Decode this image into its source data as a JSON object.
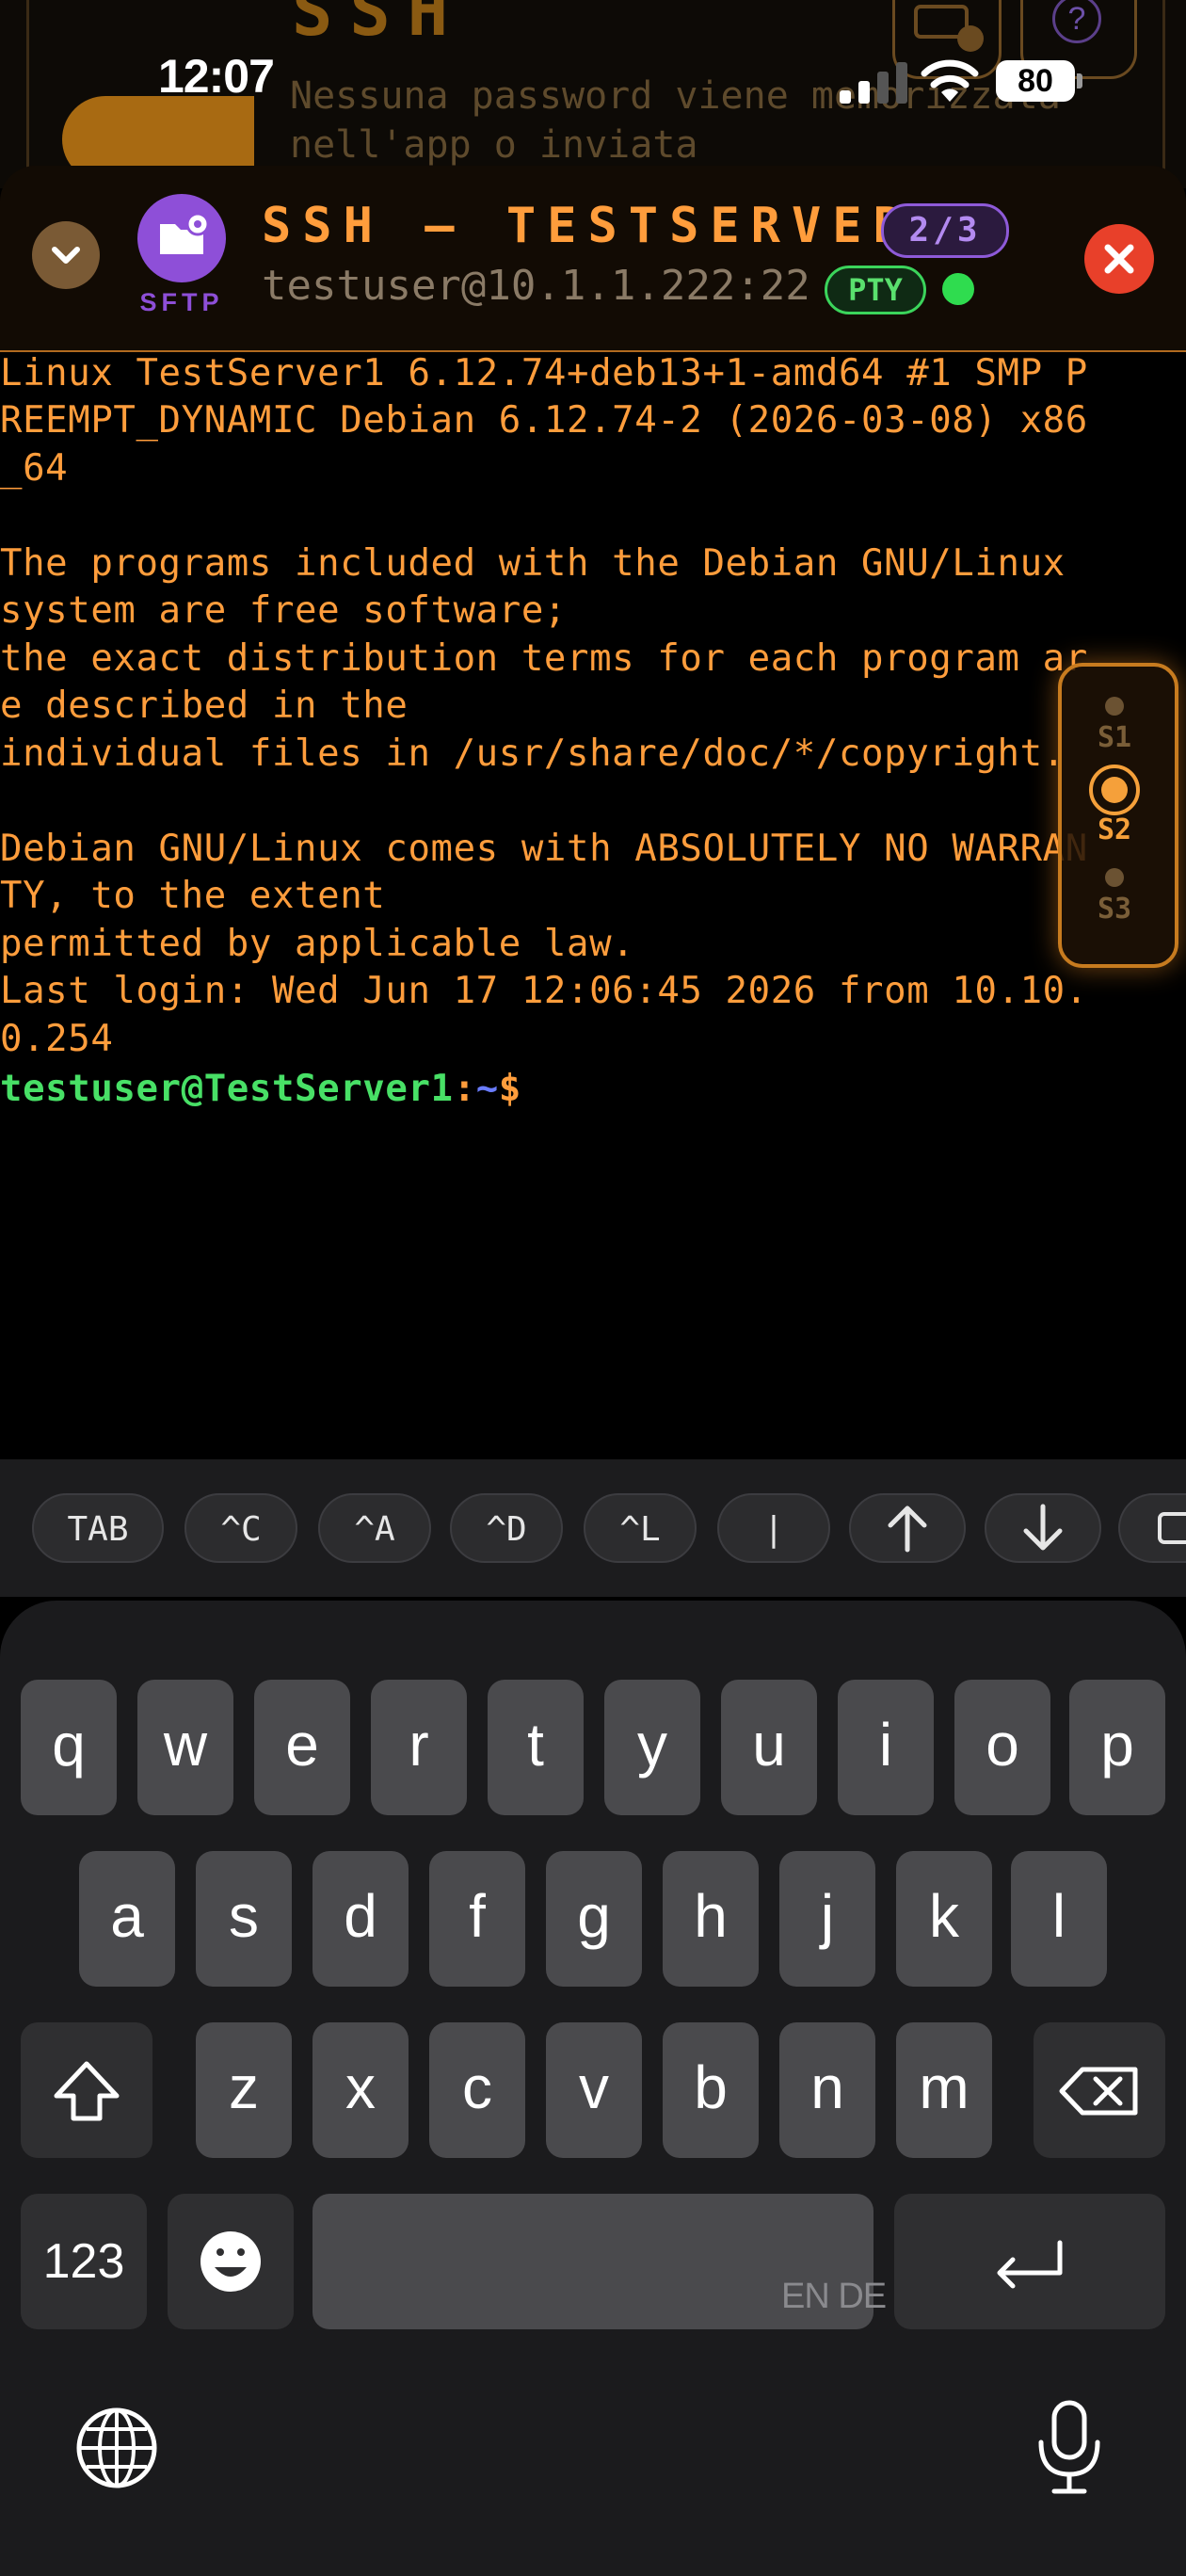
{
  "status_bar": {
    "time": "12:07",
    "battery": "80"
  },
  "background_app": {
    "title": "SSH",
    "description": "Nessuna password viene memorizzata nell'app o inviata"
  },
  "session_header": {
    "sftp_label": "SFTP",
    "title": "SSH – TESTSERVER",
    "session_count": "2/3",
    "host": "testuser@10.1.1.222:22",
    "pty_label": "PTY"
  },
  "terminal": {
    "lines": [
      "Linux TestServer1 6.12.74+deb13+1-amd64 #1 SMP P",
      "REEMPT_DYNAMIC Debian 6.12.74-2 (2026-03-08) x86",
      "_64",
      "",
      "The programs included with the Debian GNU/Linux",
      "system are free software;",
      "the exact distribution terms for each program ar",
      "e described in the",
      "individual files in /usr/share/doc/*/copyright.",
      "",
      "Debian GNU/Linux comes with ABSOLUTELY NO WARRAN",
      "TY, to the extent",
      "permitted by applicable law.",
      "Last login: Wed Jun 17 12:06:45 2026 from 10.10.",
      "0.254"
    ],
    "prompt_user": "testuser@TestServer1",
    "prompt_sep": ":",
    "prompt_path": "~",
    "prompt_sign": "$"
  },
  "session_rail": {
    "items": [
      "S1",
      "S2",
      "S3"
    ],
    "active": "S2"
  },
  "accessory_keys": [
    "TAB",
    "^C",
    "^A",
    "^D",
    "^L",
    "|"
  ],
  "keyboard": {
    "row1": [
      "q",
      "w",
      "e",
      "r",
      "t",
      "y",
      "u",
      "i",
      "o",
      "p"
    ],
    "row2": [
      "a",
      "s",
      "d",
      "f",
      "g",
      "h",
      "j",
      "k",
      "l"
    ],
    "row3": [
      "z",
      "x",
      "c",
      "v",
      "b",
      "n",
      "m"
    ],
    "numbers_label": "123",
    "space_hint": "EN DE"
  }
}
